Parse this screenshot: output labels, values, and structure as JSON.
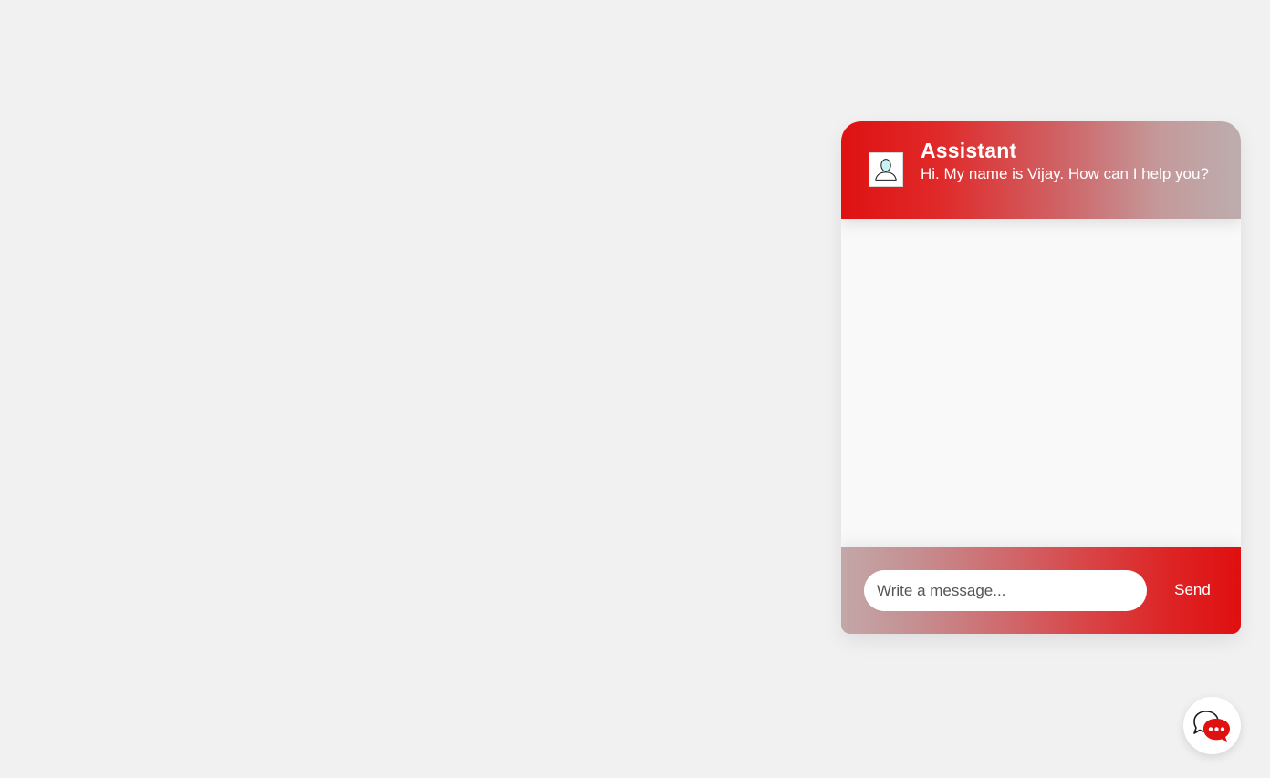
{
  "chat": {
    "header": {
      "title": "Assistant",
      "subtitle": "Hi. My name is Vijay. How can I help you?",
      "avatar_icon": "user-avatar-icon"
    },
    "footer": {
      "input_placeholder": "Write a message...",
      "input_value": "",
      "send_label": "Send"
    },
    "launcher_icon": "chat-bubbles-icon"
  },
  "colors": {
    "accent_red": "#e00f10",
    "header_fade": "#bdadae",
    "page_background": "#f1f1f1",
    "messages_background": "#f9f9f9"
  }
}
